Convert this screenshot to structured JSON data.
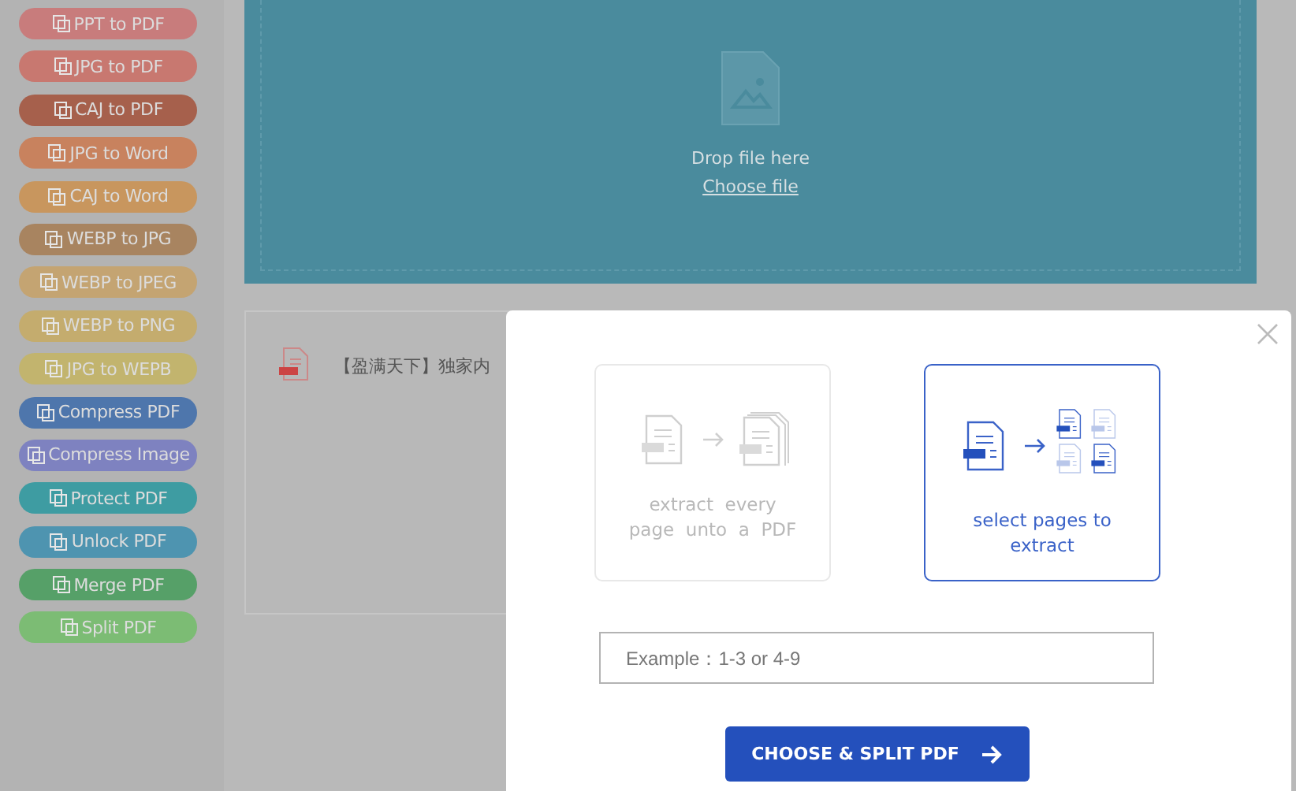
{
  "sidebar": {
    "items": [
      {
        "label": "PPT to PDF",
        "color": "#c87c7c"
      },
      {
        "label": "JPG to PDF",
        "color": "#c87870"
      },
      {
        "label": "CAJ to PDF",
        "color": "#a6604c"
      },
      {
        "label": "JPG to Word",
        "color": "#c8825e"
      },
      {
        "label": "CAJ to Word",
        "color": "#c8965e"
      },
      {
        "label": "WEBP to JPG",
        "color": "#a88460"
      },
      {
        "label": "WEBP to JPEG",
        "color": "#c4a472"
      },
      {
        "label": "WEBP to PNG",
        "color": "#c4ac6e"
      },
      {
        "label": "JPG to WEPB",
        "color": "#c2b46e"
      },
      {
        "label": "Compress PDF",
        "color": "#4e76ac"
      },
      {
        "label": "Compress Image",
        "color": "#7e82c0"
      },
      {
        "label": "Protect PDF",
        "color": "#3e9ca2"
      },
      {
        "label": "Unlock PDF",
        "color": "#4e94b0"
      },
      {
        "label": "Merge PDF",
        "color": "#56a068"
      },
      {
        "label": "Split PDF",
        "color": "#7cbc74"
      }
    ]
  },
  "upload": {
    "prompt": "Drop file here",
    "link": "Choose file"
  },
  "file": {
    "name": "【盈满天下】独家内"
  },
  "dialog": {
    "options": [
      {
        "label": "extract  every page  unto  a  PDF",
        "selected": false
      },
      {
        "label": "select pages to extract",
        "selected": true
      }
    ],
    "range_field": {
      "placeholder": "Example：1-3 or 4-9"
    },
    "button": "CHOOSE & SPLIT  PDF"
  }
}
